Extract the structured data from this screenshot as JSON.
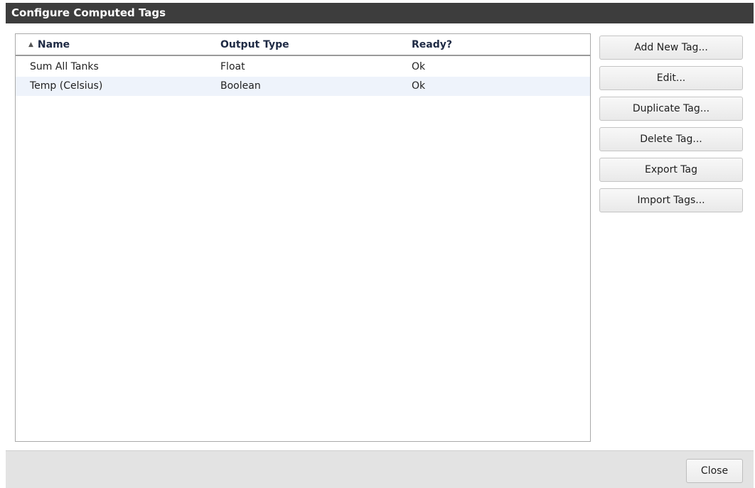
{
  "dialog": {
    "title": "Configure Computed Tags"
  },
  "table": {
    "columns": {
      "name": "Name",
      "output_type": "Output Type",
      "ready": "Ready?"
    },
    "sort_icon": "sort-ascending-icon",
    "rows": [
      {
        "name": "Sum All Tanks",
        "output_type": "Float",
        "ready": "Ok"
      },
      {
        "name": "Temp (Celsius)",
        "output_type": "Boolean",
        "ready": "Ok"
      }
    ]
  },
  "buttons": {
    "add_new_tag": "Add New Tag...",
    "edit": "Edit...",
    "duplicate_tag": "Duplicate Tag...",
    "delete_tag": "Delete Tag...",
    "export_tag": "Export Tag",
    "import_tags": "Import Tags..."
  },
  "footer": {
    "close": "Close"
  },
  "colors": {
    "titlebar_bg": "#3d3d3d",
    "selected_row_bg": "#eef3fb",
    "footer_bg": "#e3e3e3"
  }
}
